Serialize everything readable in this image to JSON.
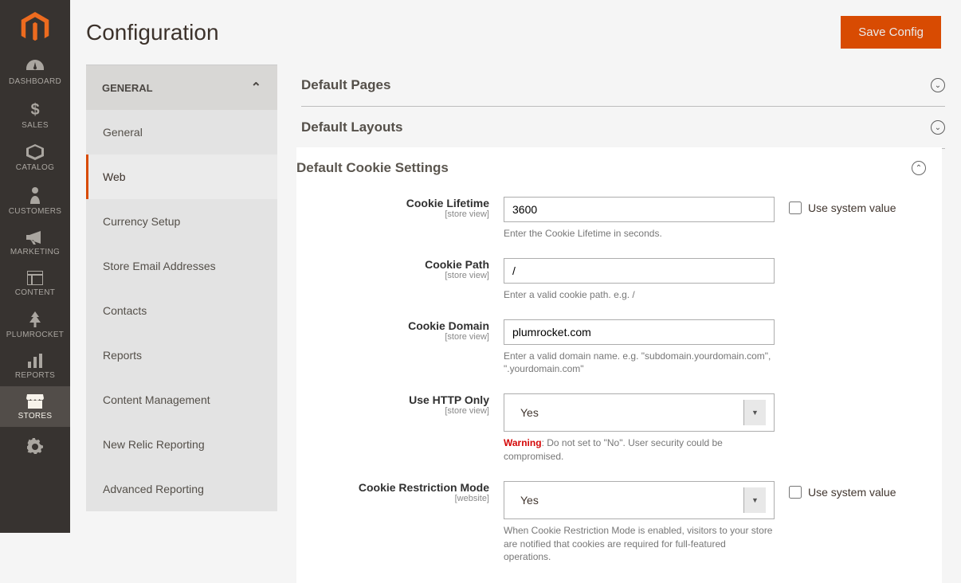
{
  "nav": {
    "items": [
      {
        "label": "DASHBOARD",
        "icon": "dashboard"
      },
      {
        "label": "SALES",
        "icon": "dollar"
      },
      {
        "label": "CATALOG",
        "icon": "box"
      },
      {
        "label": "CUSTOMERS",
        "icon": "person"
      },
      {
        "label": "MARKETING",
        "icon": "megaphone"
      },
      {
        "label": "CONTENT",
        "icon": "layout"
      },
      {
        "label": "PLUMROCKET",
        "icon": "tree"
      },
      {
        "label": "REPORTS",
        "icon": "bars"
      },
      {
        "label": "STORES",
        "icon": "storefront"
      }
    ]
  },
  "page": {
    "title": "Configuration",
    "save_label": "Save Config"
  },
  "sidebar": {
    "section_label": "GENERAL",
    "links": [
      "General",
      "Web",
      "Currency Setup",
      "Store Email Addresses",
      "Contacts",
      "Reports",
      "Content Management",
      "New Relic Reporting",
      "Advanced Reporting"
    ]
  },
  "panels": {
    "default_pages": "Default Pages",
    "default_layouts": "Default Layouts",
    "cookie_settings": "Default Cookie Settings"
  },
  "fields": {
    "cookie_lifetime": {
      "label": "Cookie Lifetime",
      "scope": "[store view]",
      "value": "3600",
      "note": "Enter the Cookie Lifetime in seconds.",
      "sys_label": "Use system value"
    },
    "cookie_path": {
      "label": "Cookie Path",
      "scope": "[store view]",
      "value": "/",
      "note": "Enter a valid cookie path. e.g. /"
    },
    "cookie_domain": {
      "label": "Cookie Domain",
      "scope": "[store view]",
      "value": "plumrocket.com",
      "note": "Enter a valid domain name. e.g. \"subdomain.yourdomain.com\", \".yourdomain.com\""
    },
    "use_http_only": {
      "label": "Use HTTP Only",
      "scope": "[store view]",
      "value": "Yes",
      "warn_label": "Warning",
      "warn_text": ": Do not set to \"No\". User security could be compromised."
    },
    "cookie_restriction": {
      "label": "Cookie Restriction Mode",
      "scope": "[website]",
      "value": "Yes",
      "note": "When Cookie Restriction Mode is enabled, visitors to your store are notified that cookies are required for full-featured operations.",
      "sys_label": "Use system value"
    }
  }
}
